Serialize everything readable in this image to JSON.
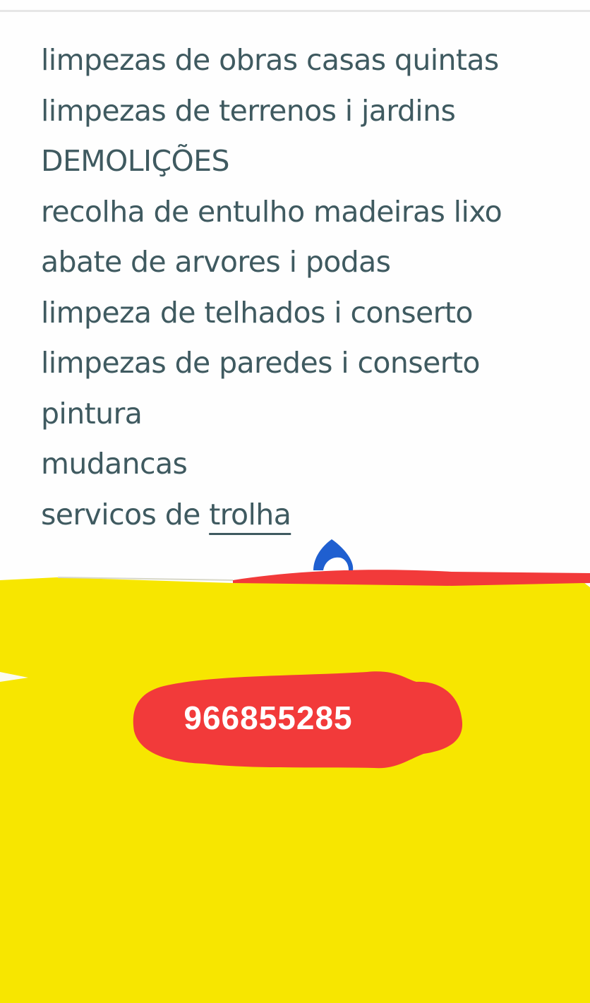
{
  "services": [
    "limpezas de obras casas quintas",
    "limpezas de terrenos i jardins",
    "DEMOLIÇÕES",
    "recolha de entulho madeiras lixo",
    "abate de arvores i podas",
    "limpeza de telhados i conserto",
    "limpezas de paredes i conserto",
    "pintura",
    "mudancas"
  ],
  "last_service": {
    "prefix": "servicos de ",
    "underlined_word": "trolha"
  },
  "phone": "966855285",
  "colors": {
    "text": "#3f5a60",
    "highlight_yellow": "#f7e600",
    "highlight_red": "#f23a3a",
    "handle_blue": "#1f5fd0",
    "background": "#fefefe"
  },
  "icons": {
    "selection_handle": "text-selection-handle-icon"
  }
}
